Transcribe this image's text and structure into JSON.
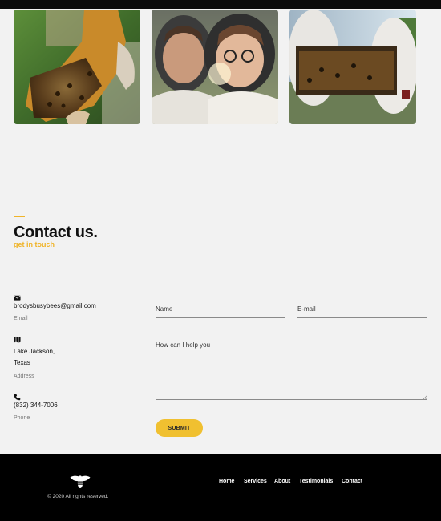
{
  "gallery": {
    "photos": [
      {
        "alt": "Hand holding honeycomb frame with bees"
      },
      {
        "alt": "Two beekeepers in veiled hats smiling"
      },
      {
        "alt": "Beekeepers holding a frame against the sky"
      }
    ]
  },
  "contact": {
    "heading": "Contact us.",
    "subheading": "get in touch",
    "email": {
      "value": "brodysbusybees@gmail.com",
      "label": "Email",
      "icon": "envelope-icon"
    },
    "address": {
      "line1": "Lake Jackson,",
      "line2": "Texas",
      "label": "Address",
      "icon": "map-icon"
    },
    "phone": {
      "value": "(832) 344-7006",
      "label": "Phone",
      "icon": "phone-icon"
    }
  },
  "form": {
    "name_placeholder": "Name",
    "email_placeholder": "E-mail",
    "message_placeholder": "How can I help you",
    "submit_label": "SUBMIT"
  },
  "footer": {
    "copyright": "© 2020 All rights reserved.",
    "nav": [
      "Home",
      "Services",
      "About",
      "Testimonials",
      "Contact"
    ]
  },
  "colors": {
    "accent": "#f0b429",
    "button": "#f0c030",
    "footer": "#000000",
    "background": "#f2f2f2"
  }
}
